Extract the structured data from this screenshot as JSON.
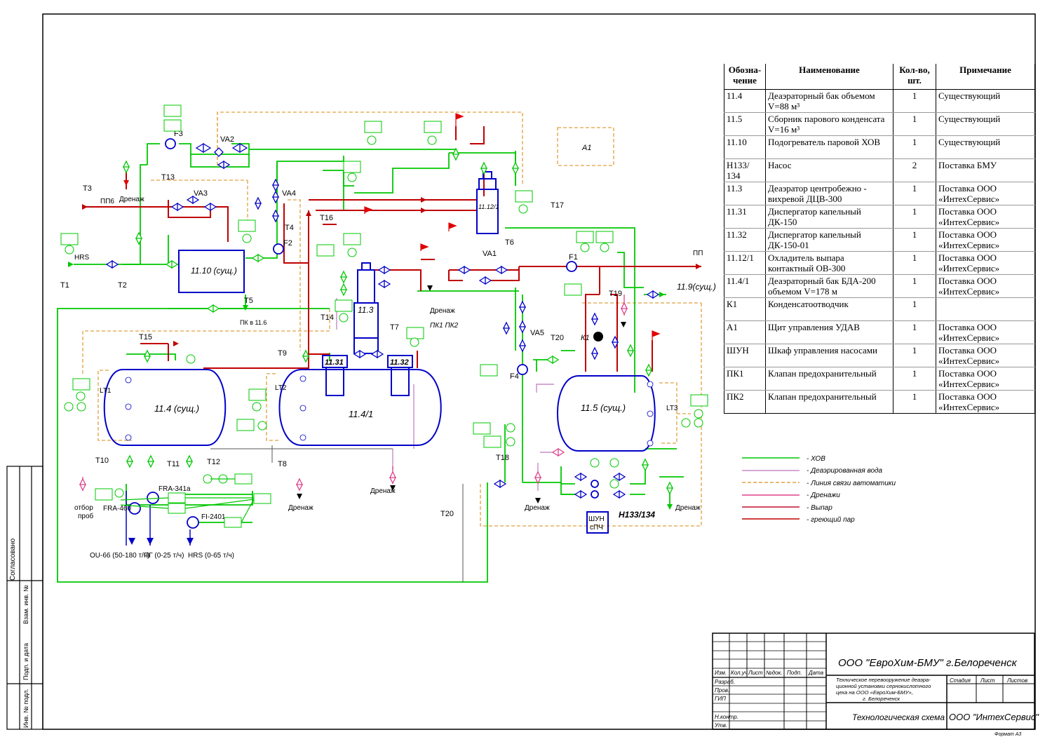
{
  "colors": {
    "water": "#00c800",
    "deaerated": "#c88cc8",
    "automation": "#e0a040",
    "drainage": "#e0408c",
    "vapor": "#c01030",
    "steam": "#c00000",
    "equipment": "#0000c8"
  },
  "spec_table": {
    "headers": [
      "Обозна-\nчение",
      "Наименование",
      "Кол-во,\nшт.",
      "Примечание"
    ],
    "rows": [
      {
        "code": "11.4",
        "name": "Деаэраторный бак объемом V=88 м³",
        "qty": "1",
        "note": "Существующий"
      },
      {
        "code": "11.5",
        "name": "Сборник парового конденсата V=16 м³",
        "qty": "1",
        "note": "Существующий"
      },
      {
        "code": "11.10",
        "name": "Подогреватель паровой ХОВ",
        "qty": "1",
        "note": "Существующий"
      },
      {
        "code": "Н133/ 134",
        "name": "Насос",
        "qty": "2",
        "note": "Поставка БМУ"
      },
      {
        "code": "11.3",
        "name": "Деаэратор центробежно - вихревой ДЦВ-300",
        "qty": "1",
        "note": "Поставка ООО «ИнтехСервис»"
      },
      {
        "code": "11.31",
        "name": "Диспергатор капельный ДК-150",
        "qty": "1",
        "note": "Поставка ООО «ИнтехСервис»"
      },
      {
        "code": "11.32",
        "name": "Диспергатор капельный ДК-150-01",
        "qty": "1",
        "note": "Поставка ООО «ИнтехСервис»"
      },
      {
        "code": "11.12/1",
        "name": "Охладитель выпара контактный ОВ-300",
        "qty": "1",
        "note": "Поставка ООО «ИнтехСервис»"
      },
      {
        "code": "11.4/1",
        "name": "Деаэраторный бак БДА-200 объемом V=178 м",
        "qty": "1",
        "note": "Поставка ООО «ИнтехСервис»"
      },
      {
        "code": "К1",
        "name": "Конденсатоотводчик",
        "qty": "1",
        "note": ""
      },
      {
        "code": "А1",
        "name": "Щит управления УДАВ",
        "qty": "1",
        "note": "Поставка ООО «ИнтехСервис»"
      },
      {
        "code": "ШУН",
        "name": "Шкаф управления насосами",
        "qty": "1",
        "note": "Поставка ООО «ИнтехСервис»"
      },
      {
        "code": "ПК1",
        "name": "Клапан предохранительный",
        "qty": "1",
        "note": "Поставка ООО «ИнтехСервис»"
      },
      {
        "code": "ПК2",
        "name": "Клапан предохранительный",
        "qty": "1",
        "note": "Поставка ООО «ИнтехСервис»"
      }
    ]
  },
  "legend": [
    {
      "label": "- ХОВ",
      "key": "water",
      "style": "solid"
    },
    {
      "label": "- Деаэрированная вода",
      "key": "deaerated",
      "style": "solid"
    },
    {
      "label": "- Линия связи автоматики",
      "key": "automation",
      "style": "dashed"
    },
    {
      "label": "- Дренажи",
      "key": "drainage",
      "style": "solid"
    },
    {
      "label": "- Выпар",
      "key": "vapor",
      "style": "solid"
    },
    {
      "label": "- греющий пар",
      "key": "steam",
      "style": "solid"
    }
  ],
  "title_block": {
    "company": "ООО \"ЕвроХим-БМУ\" г.Белореченск",
    "project": "Техническое перевооружение деаэра-ционной установки сернокислотного цеха на ООО «ЕвроХим-БМУ», г. Белореченск",
    "stage_label": "Стадия",
    "sheet_label": "Лист",
    "sheets_label": "Листов",
    "drawing_title": "Технологическая схема",
    "org": "ООО \"ИнтехСервис\"",
    "col_headers": [
      "Изм.",
      "Кол.уч",
      "Лист",
      "№док.",
      "Подп.",
      "Дата"
    ],
    "roles": [
      "Разраб.",
      "Пров.",
      "ГИП",
      "",
      "Н.контр.",
      "Утв."
    ],
    "format": "Формат А3"
  },
  "side_stamp": {
    "agreed": "Согласовано",
    "inv": "Инв. № подл.",
    "sign": "Подп. и дата",
    "replaces": "Взам. инв. №"
  },
  "equipment": {
    "e11_10": "11.10 (сущ.)",
    "e11_4": "11.4 (сущ.)",
    "e11_4_1": "11.4/1",
    "e11_5": "11.5 (сущ.)",
    "e11_3": "11.3",
    "e11_31": "11.31",
    "e11_32": "11.32",
    "e11_12_1": "11.12/1",
    "a1": "А1",
    "shun": "ШУН\nсПЧ",
    "pump": "Н133/134",
    "k1": "К1",
    "pk": "ПК1 ПК2",
    "out11_9": "11.9(сущ.)"
  },
  "streams": {
    "T1": "Т1",
    "T2": "Т2",
    "T3": "Т3",
    "T4": "Т4",
    "T5": "Т5",
    "T6": "Т6",
    "T7": "Т7",
    "T8": "Т8",
    "T9": "Т9",
    "T10": "Т10",
    "T11": "Т11",
    "T12": "Т12",
    "T13": "Т13",
    "T14": "Т14",
    "T15": "Т15",
    "T16": "Т16",
    "T17": "Т17",
    "T18": "Т18",
    "T19": "Т19",
    "T20": "Т20",
    "T20b": "Т20",
    "pp6": "ПП6",
    "pp": "ПП",
    "hrs": "HRS",
    "pk11_6": "ПК в 11.6"
  },
  "valves": {
    "F1": "F1",
    "F2": "F2",
    "F3": "F3",
    "F4": "F4",
    "VA1": "VA1",
    "VA2": "VA2",
    "VA3": "VA3",
    "VA4": "VA4",
    "VA5": "VA5",
    "LT1": "LT1",
    "LT2": "LT2",
    "LT3": "LT3"
  },
  "outputs": {
    "ou66": "OU-66 (50-180 т/ч)",
    "pg": "ПГ (0-25 т/ч)",
    "hrs": "HRS (0-65 т/ч)",
    "fra460": "FRA-460",
    "fra341": "FRA-341a",
    "fi2401": "FI-2401",
    "sampling": "отбор\nпроб",
    "drain": "Дренаж"
  }
}
